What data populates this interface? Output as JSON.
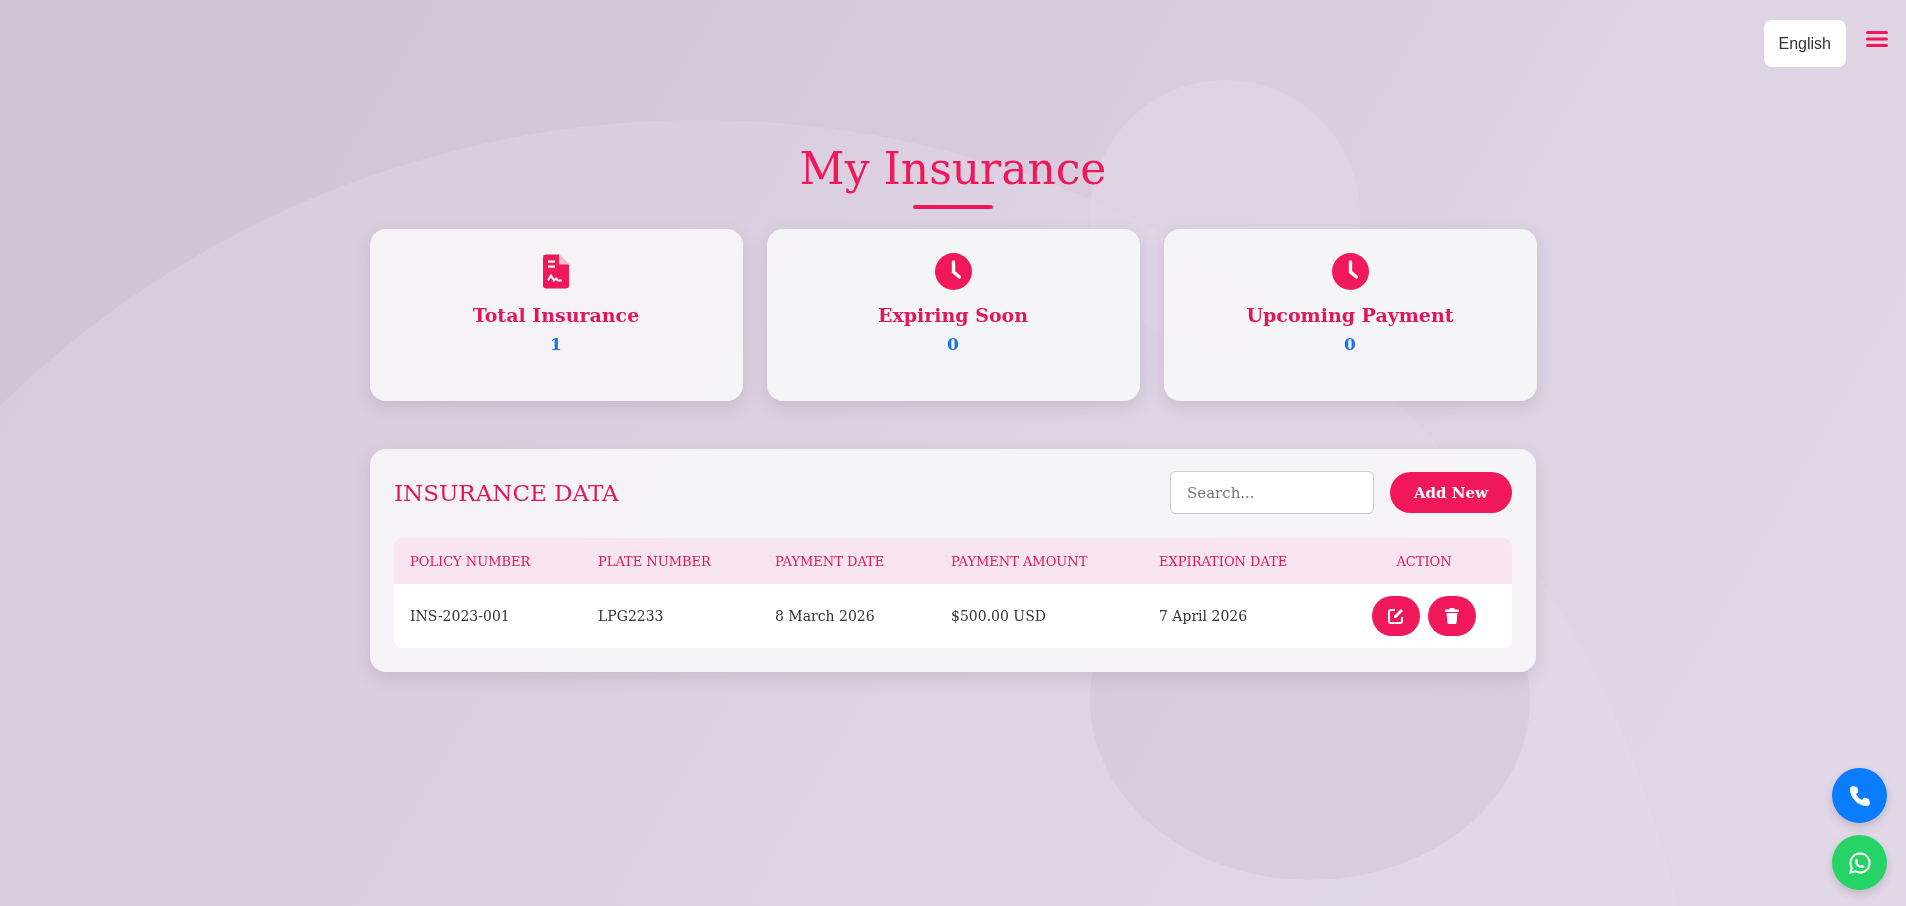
{
  "language_button": "English",
  "title": "My Insurance",
  "stats": [
    {
      "kind": "document",
      "label": "Total Insurance",
      "value": "1"
    },
    {
      "kind": "clock",
      "label": "Expiring Soon",
      "value": "0"
    },
    {
      "kind": "clock",
      "label": "Upcoming Payment",
      "value": "0"
    }
  ],
  "panel": {
    "title": "INSURANCE DATA",
    "search": {
      "placeholder": "Search..."
    },
    "add_button": "Add New"
  },
  "table": {
    "columns": [
      "POLICY NUMBER",
      "PLATE NUMBER",
      "PAYMENT DATE",
      "PAYMENT AMOUNT",
      "EXPIRATION DATE",
      "ACTION"
    ],
    "rows": [
      {
        "cells": [
          "INS-2023-001",
          "LPG2233",
          "8 March 2026",
          "$500.00 USD",
          "7 April 2026"
        ]
      }
    ]
  }
}
